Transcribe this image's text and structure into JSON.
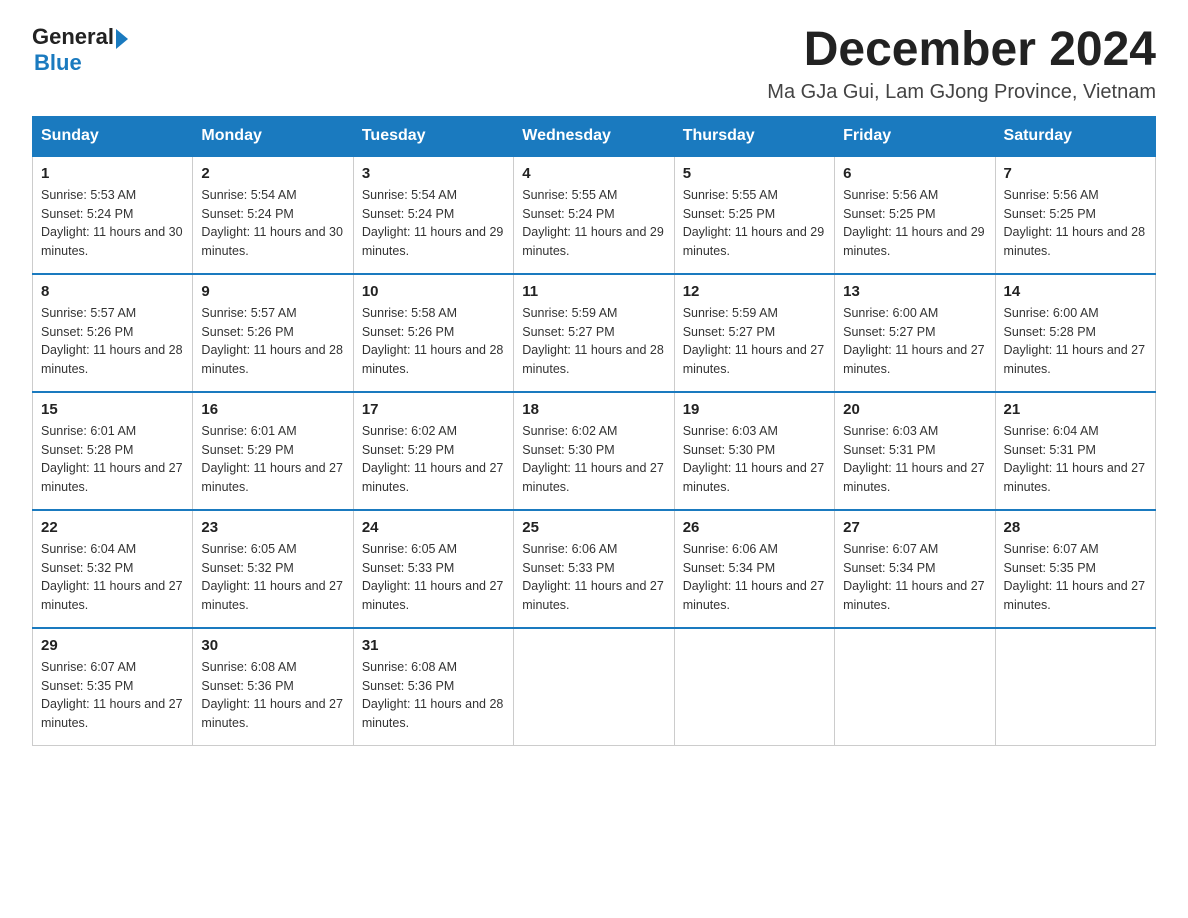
{
  "header": {
    "logo_general": "General",
    "logo_blue": "Blue",
    "month_title": "December 2024",
    "location": "Ma GJa Gui, Lam GJong Province, Vietnam"
  },
  "days_of_week": [
    "Sunday",
    "Monday",
    "Tuesday",
    "Wednesday",
    "Thursday",
    "Friday",
    "Saturday"
  ],
  "weeks": [
    [
      {
        "day": "1",
        "sunrise": "5:53 AM",
        "sunset": "5:24 PM",
        "daylight": "11 hours and 30 minutes."
      },
      {
        "day": "2",
        "sunrise": "5:54 AM",
        "sunset": "5:24 PM",
        "daylight": "11 hours and 30 minutes."
      },
      {
        "day": "3",
        "sunrise": "5:54 AM",
        "sunset": "5:24 PM",
        "daylight": "11 hours and 29 minutes."
      },
      {
        "day": "4",
        "sunrise": "5:55 AM",
        "sunset": "5:24 PM",
        "daylight": "11 hours and 29 minutes."
      },
      {
        "day": "5",
        "sunrise": "5:55 AM",
        "sunset": "5:25 PM",
        "daylight": "11 hours and 29 minutes."
      },
      {
        "day": "6",
        "sunrise": "5:56 AM",
        "sunset": "5:25 PM",
        "daylight": "11 hours and 29 minutes."
      },
      {
        "day": "7",
        "sunrise": "5:56 AM",
        "sunset": "5:25 PM",
        "daylight": "11 hours and 28 minutes."
      }
    ],
    [
      {
        "day": "8",
        "sunrise": "5:57 AM",
        "sunset": "5:26 PM",
        "daylight": "11 hours and 28 minutes."
      },
      {
        "day": "9",
        "sunrise": "5:57 AM",
        "sunset": "5:26 PM",
        "daylight": "11 hours and 28 minutes."
      },
      {
        "day": "10",
        "sunrise": "5:58 AM",
        "sunset": "5:26 PM",
        "daylight": "11 hours and 28 minutes."
      },
      {
        "day": "11",
        "sunrise": "5:59 AM",
        "sunset": "5:27 PM",
        "daylight": "11 hours and 28 minutes."
      },
      {
        "day": "12",
        "sunrise": "5:59 AM",
        "sunset": "5:27 PM",
        "daylight": "11 hours and 27 minutes."
      },
      {
        "day": "13",
        "sunrise": "6:00 AM",
        "sunset": "5:27 PM",
        "daylight": "11 hours and 27 minutes."
      },
      {
        "day": "14",
        "sunrise": "6:00 AM",
        "sunset": "5:28 PM",
        "daylight": "11 hours and 27 minutes."
      }
    ],
    [
      {
        "day": "15",
        "sunrise": "6:01 AM",
        "sunset": "5:28 PM",
        "daylight": "11 hours and 27 minutes."
      },
      {
        "day": "16",
        "sunrise": "6:01 AM",
        "sunset": "5:29 PM",
        "daylight": "11 hours and 27 minutes."
      },
      {
        "day": "17",
        "sunrise": "6:02 AM",
        "sunset": "5:29 PM",
        "daylight": "11 hours and 27 minutes."
      },
      {
        "day": "18",
        "sunrise": "6:02 AM",
        "sunset": "5:30 PM",
        "daylight": "11 hours and 27 minutes."
      },
      {
        "day": "19",
        "sunrise": "6:03 AM",
        "sunset": "5:30 PM",
        "daylight": "11 hours and 27 minutes."
      },
      {
        "day": "20",
        "sunrise": "6:03 AM",
        "sunset": "5:31 PM",
        "daylight": "11 hours and 27 minutes."
      },
      {
        "day": "21",
        "sunrise": "6:04 AM",
        "sunset": "5:31 PM",
        "daylight": "11 hours and 27 minutes."
      }
    ],
    [
      {
        "day": "22",
        "sunrise": "6:04 AM",
        "sunset": "5:32 PM",
        "daylight": "11 hours and 27 minutes."
      },
      {
        "day": "23",
        "sunrise": "6:05 AM",
        "sunset": "5:32 PM",
        "daylight": "11 hours and 27 minutes."
      },
      {
        "day": "24",
        "sunrise": "6:05 AM",
        "sunset": "5:33 PM",
        "daylight": "11 hours and 27 minutes."
      },
      {
        "day": "25",
        "sunrise": "6:06 AM",
        "sunset": "5:33 PM",
        "daylight": "11 hours and 27 minutes."
      },
      {
        "day": "26",
        "sunrise": "6:06 AM",
        "sunset": "5:34 PM",
        "daylight": "11 hours and 27 minutes."
      },
      {
        "day": "27",
        "sunrise": "6:07 AM",
        "sunset": "5:34 PM",
        "daylight": "11 hours and 27 minutes."
      },
      {
        "day": "28",
        "sunrise": "6:07 AM",
        "sunset": "5:35 PM",
        "daylight": "11 hours and 27 minutes."
      }
    ],
    [
      {
        "day": "29",
        "sunrise": "6:07 AM",
        "sunset": "5:35 PM",
        "daylight": "11 hours and 27 minutes."
      },
      {
        "day": "30",
        "sunrise": "6:08 AM",
        "sunset": "5:36 PM",
        "daylight": "11 hours and 27 minutes."
      },
      {
        "day": "31",
        "sunrise": "6:08 AM",
        "sunset": "5:36 PM",
        "daylight": "11 hours and 28 minutes."
      },
      null,
      null,
      null,
      null
    ]
  ]
}
